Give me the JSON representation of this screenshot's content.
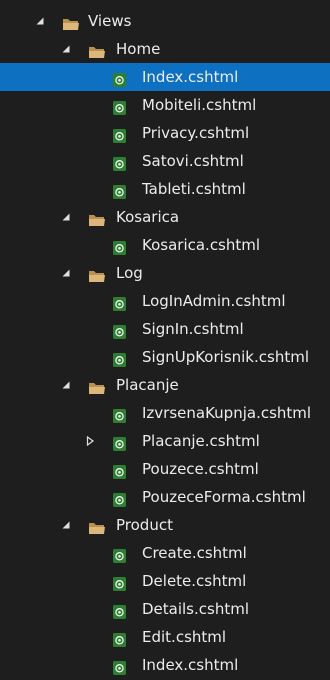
{
  "tree": [
    {
      "label": "Views",
      "type": "folder",
      "depth": 0,
      "expander": "expanded"
    },
    {
      "label": "Home",
      "type": "folder",
      "depth": 1,
      "expander": "expanded"
    },
    {
      "label": "Index.cshtml",
      "type": "file",
      "depth": 2,
      "selected": true
    },
    {
      "label": "Mobiteli.cshtml",
      "type": "file",
      "depth": 2
    },
    {
      "label": "Privacy.cshtml",
      "type": "file",
      "depth": 2
    },
    {
      "label": "Satovi.cshtml",
      "type": "file",
      "depth": 2
    },
    {
      "label": "Tableti.cshtml",
      "type": "file",
      "depth": 2
    },
    {
      "label": "Kosarica",
      "type": "folder",
      "depth": 1,
      "expander": "expanded"
    },
    {
      "label": "Kosarica.cshtml",
      "type": "file",
      "depth": 2
    },
    {
      "label": "Log",
      "type": "folder",
      "depth": 1,
      "expander": "expanded"
    },
    {
      "label": "LogInAdmin.cshtml",
      "type": "file",
      "depth": 2
    },
    {
      "label": "SignIn.cshtml",
      "type": "file",
      "depth": 2
    },
    {
      "label": "SignUpKorisnik.cshtml",
      "type": "file",
      "depth": 2
    },
    {
      "label": "Placanje",
      "type": "folder",
      "depth": 1,
      "expander": "expanded"
    },
    {
      "label": "IzvrsenaKupnja.cshtml",
      "type": "file",
      "depth": 2
    },
    {
      "label": "Placanje.cshtml",
      "type": "file",
      "depth": 2,
      "expander": "collapsed"
    },
    {
      "label": "Pouzece.cshtml",
      "type": "file",
      "depth": 2
    },
    {
      "label": "PouzeceForma.cshtml",
      "type": "file",
      "depth": 2
    },
    {
      "label": "Product",
      "type": "folder",
      "depth": 1,
      "expander": "expanded"
    },
    {
      "label": "Create.cshtml",
      "type": "file",
      "depth": 2
    },
    {
      "label": "Delete.cshtml",
      "type": "file",
      "depth": 2
    },
    {
      "label": "Details.cshtml",
      "type": "file",
      "depth": 2
    },
    {
      "label": "Edit.cshtml",
      "type": "file",
      "depth": 2
    },
    {
      "label": "Index.cshtml",
      "type": "file",
      "depth": 2
    }
  ],
  "colors": {
    "background": "#1e1e1e",
    "selection": "#0e70c0",
    "folder": "#dcb67a",
    "folder_dark": "#b8914c",
    "file_bg": "#2f7d32",
    "file_glyph": "#e8f5e9",
    "text": "#ececec",
    "expander": "#e0e0e0"
  }
}
